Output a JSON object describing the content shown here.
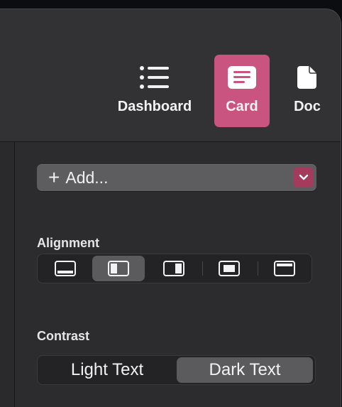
{
  "toolbar": {
    "dashboard_label": "Dashboard",
    "card_label": "Card",
    "doc_label": "Doc"
  },
  "inspector": {
    "add_label": "Add...",
    "alignment_label": "Alignment",
    "alignment_options": [
      "bottom-bar",
      "left-panel",
      "right-panel",
      "center-box",
      "top-bar"
    ],
    "alignment_selected": "left-panel",
    "contrast_label": "Contrast",
    "contrast_options": [
      "Light Text",
      "Dark Text"
    ],
    "contrast_selected": "Dark Text"
  },
  "colors": {
    "accent": "#c8547f",
    "accent_dark": "#a43a5c"
  }
}
